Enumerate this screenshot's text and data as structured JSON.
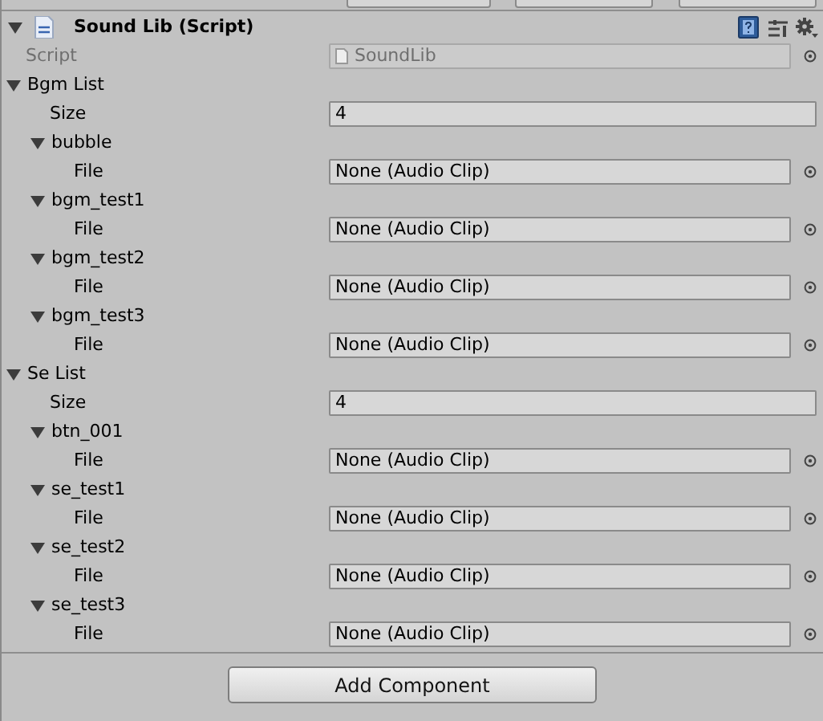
{
  "component": {
    "title": "Sound Lib (Script)",
    "expanded": true
  },
  "rows": [
    {
      "kind": "script",
      "label": "Script",
      "value": "SoundLib",
      "disabled": true
    },
    {
      "kind": "foldout",
      "label": "Bgm List",
      "expanded": true,
      "children": [
        {
          "kind": "int",
          "label": "Size",
          "value": "4"
        },
        {
          "kind": "foldout",
          "label": "bubble",
          "expanded": true,
          "children": [
            {
              "kind": "object",
              "label": "File",
              "value": "None (Audio Clip)"
            }
          ]
        },
        {
          "kind": "foldout",
          "label": "bgm_test1",
          "expanded": true,
          "children": [
            {
              "kind": "object",
              "label": "File",
              "value": "None (Audio Clip)"
            }
          ]
        },
        {
          "kind": "foldout",
          "label": "bgm_test2",
          "expanded": true,
          "children": [
            {
              "kind": "object",
              "label": "File",
              "value": "None (Audio Clip)"
            }
          ]
        },
        {
          "kind": "foldout",
          "label": "bgm_test3",
          "expanded": true,
          "children": [
            {
              "kind": "object",
              "label": "File",
              "value": "None (Audio Clip)"
            }
          ]
        }
      ]
    },
    {
      "kind": "foldout",
      "label": "Se List",
      "expanded": true,
      "children": [
        {
          "kind": "int",
          "label": "Size",
          "value": "4"
        },
        {
          "kind": "foldout",
          "label": "btn_001",
          "expanded": true,
          "children": [
            {
              "kind": "object",
              "label": "File",
              "value": "None (Audio Clip)"
            }
          ]
        },
        {
          "kind": "foldout",
          "label": "se_test1",
          "expanded": true,
          "children": [
            {
              "kind": "object",
              "label": "File",
              "value": "None (Audio Clip)"
            }
          ]
        },
        {
          "kind": "foldout",
          "label": "se_test2",
          "expanded": true,
          "children": [
            {
              "kind": "object",
              "label": "File",
              "value": "None (Audio Clip)"
            }
          ]
        },
        {
          "kind": "foldout",
          "label": "se_test3",
          "expanded": true,
          "children": [
            {
              "kind": "object",
              "label": "File",
              "value": "None (Audio Clip)"
            }
          ]
        }
      ]
    }
  ],
  "add_button": "Add Component"
}
